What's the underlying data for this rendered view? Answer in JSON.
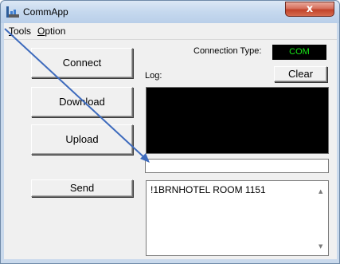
{
  "window": {
    "title": "CommApp",
    "close_label": "x"
  },
  "menu": [
    {
      "accel": "T",
      "rest": "ools"
    },
    {
      "accel": "O",
      "rest": "ption"
    }
  ],
  "buttons": {
    "connect": "Connect",
    "download": "Download",
    "upload": "Upload",
    "send": "Send",
    "clear": "Clear"
  },
  "connection": {
    "label": "Connection Type:",
    "value": "COM"
  },
  "log": {
    "label": "Log:"
  },
  "send_area": {
    "text": "!1BRNHOTEL ROOM 1151"
  },
  "scroll": {
    "up": "▲",
    "down": "▼"
  },
  "colors": {
    "accent_arrow": "#3e6bbd",
    "connection_text": "#17e617",
    "log_background": "#000000"
  },
  "icons": [
    "app-icon",
    "close-icon",
    "scroll-up-icon",
    "scroll-down-icon",
    "pointer-arrow"
  ]
}
